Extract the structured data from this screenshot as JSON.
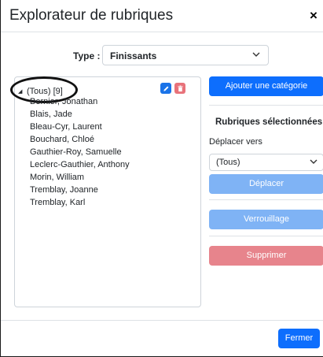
{
  "dialog": {
    "title": "Explorateur de rubriques",
    "close_symbol": "×"
  },
  "type_filter": {
    "label": "Type :",
    "selected": "Finissants"
  },
  "tree": {
    "root_label": "(Tous) [9]",
    "students": [
      "Bernier, Jonathan",
      "Blais, Jade",
      "Bleau-Cyr, Laurent",
      "Bouchard, Chloé",
      "Gauthier-Roy, Samuelle",
      "Leclerc-Gauthier, Anthony",
      "Morin, William",
      "Tremblay, Joanne",
      "Tremblay, Karl"
    ]
  },
  "side_panel": {
    "add_category": "Ajouter une catégorie",
    "selected_heading": "Rubriques sélectionnées",
    "move_to_label": "Déplacer vers",
    "move_to_selected": "(Tous)",
    "move_button": "Déplacer",
    "lock_button": "Verrouillage",
    "delete_button": "Supprimer"
  },
  "footer": {
    "close_button": "Fermer"
  },
  "colors": {
    "primary": "#0d6efd",
    "primary_disabled": "#7fb3f5",
    "danger_disabled": "#e7848c",
    "edit_icon_bg": "#1a73e8",
    "delete_icon_bg": "#e8727a"
  },
  "icons": {
    "expand": "triangle-down-icon",
    "edit": "pencil-icon",
    "delete": "trash-icon",
    "dropdown": "chevron-down-icon",
    "close": "close-icon"
  }
}
